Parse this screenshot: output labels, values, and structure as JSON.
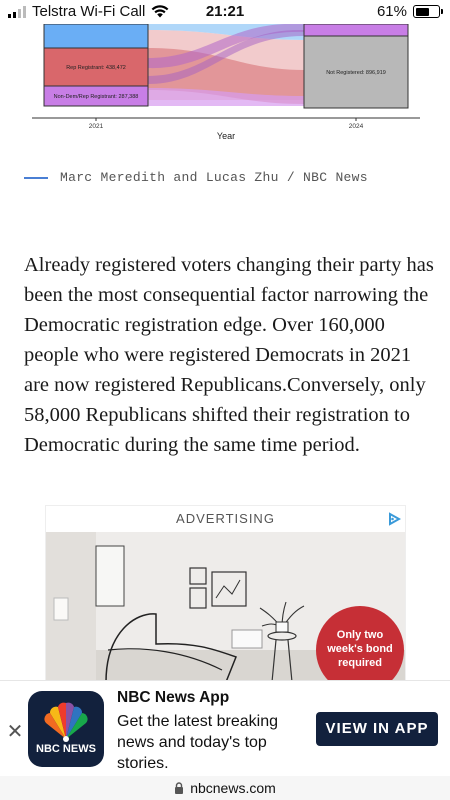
{
  "status_bar": {
    "carrier": "Telstra Wi-Fi Call",
    "time": "21:21",
    "battery_percent": "61%",
    "battery_level": 0.61,
    "signal_icon": "signal-bars-icon",
    "wifi_icon": "wifi-icon"
  },
  "chart": {
    "nodes_2021": {
      "rep": "Rep Registrant: 438,472",
      "nondem": "Non-Dem/Rep Registrant: 287,388"
    },
    "node_2024": "Not Registered: 896,919",
    "x_ticks": [
      "2021",
      "2024"
    ],
    "xlabel": "Year"
  },
  "credit": "Marc Meredith and Lucas Zhu / NBC News",
  "article": {
    "paragraph": "Already registered voters changing their party has been the most consequential factor narrowing the Democratic registration edge. Over 160,000 people who were registered Democrats in 2021 are now registered Republicans.Conversely, only 58,000 Republicans shifted their registration to Democratic during the same time period."
  },
  "ad": {
    "label": "ADVERTISING",
    "badge_text": "Only two week's bond required",
    "choices_icon": "adchoices-icon"
  },
  "app_banner": {
    "app_name": "NBC News App",
    "description": "Get the latest breaking news and today's top stories.",
    "cta_label": "VIEW IN APP",
    "icon_label": "NBC NEWS",
    "close_icon": "close-icon"
  },
  "url_bar": {
    "domain": "nbcnews.com",
    "lock_icon": "lock-icon"
  },
  "colors": {
    "navy": "#12213d",
    "blue_node": "#6aaef5",
    "rep_node": "#d9676b",
    "nondem_node": "#c87ee6",
    "not_registered": "#b8b8b8",
    "ad_badge": "#c62f36"
  }
}
